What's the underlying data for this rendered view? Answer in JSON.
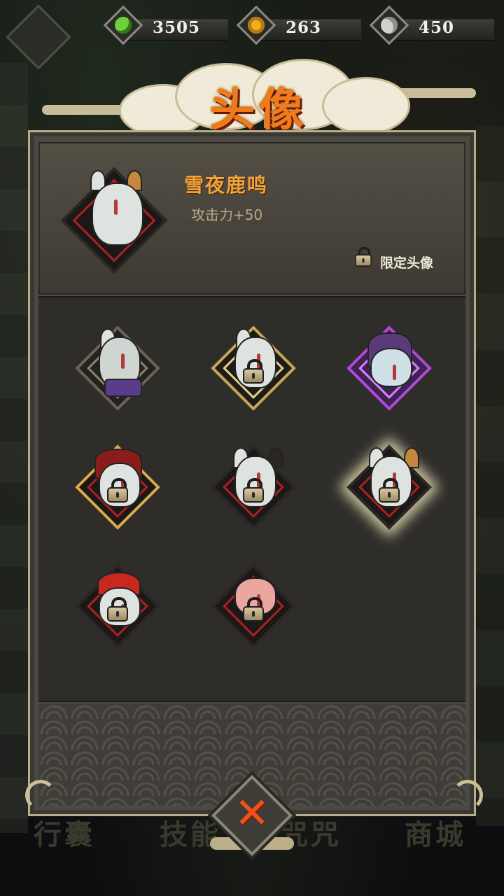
{
  "currencies": [
    {
      "name": "jade",
      "icon": "green-jade-icon",
      "amount": "3505",
      "color": "#6ecf3a"
    },
    {
      "name": "gold-coin",
      "icon": "gold-coin-icon",
      "amount": "263",
      "color": "#f0b020"
    },
    {
      "name": "silver-spiral",
      "icon": "silver-spiral-icon",
      "amount": "450",
      "color": "#d0d0cc"
    }
  ],
  "title": "头像",
  "selected_avatar": {
    "name": "雪夜鹿鸣",
    "attribute": "攻击力+50",
    "limited_label": "限定头像"
  },
  "avatars": [
    {
      "id": "wolf-purple-scarf",
      "frame": "gray",
      "locked": false
    },
    {
      "id": "wolf-gold-frame",
      "frame": "gold",
      "locked": true
    },
    {
      "id": "purple-hair-hero",
      "frame": "purple",
      "locked": false
    },
    {
      "id": "red-flame-helm",
      "frame": "goldred",
      "locked": true
    },
    {
      "id": "antler-mask",
      "frame": "red",
      "locked": true
    },
    {
      "id": "snow-night-deer",
      "frame": "red",
      "locked": true,
      "selected": true
    },
    {
      "id": "red-hat-festive",
      "frame": "red",
      "locked": true
    },
    {
      "id": "pig-mask",
      "frame": "red",
      "locked": true
    }
  ],
  "background_nav": [
    "行囊",
    "技能",
    "咒咒",
    "商城"
  ],
  "accent_colors": {
    "title": "#f07a1c",
    "name": "#f2a23a",
    "close": "#f2511a"
  }
}
